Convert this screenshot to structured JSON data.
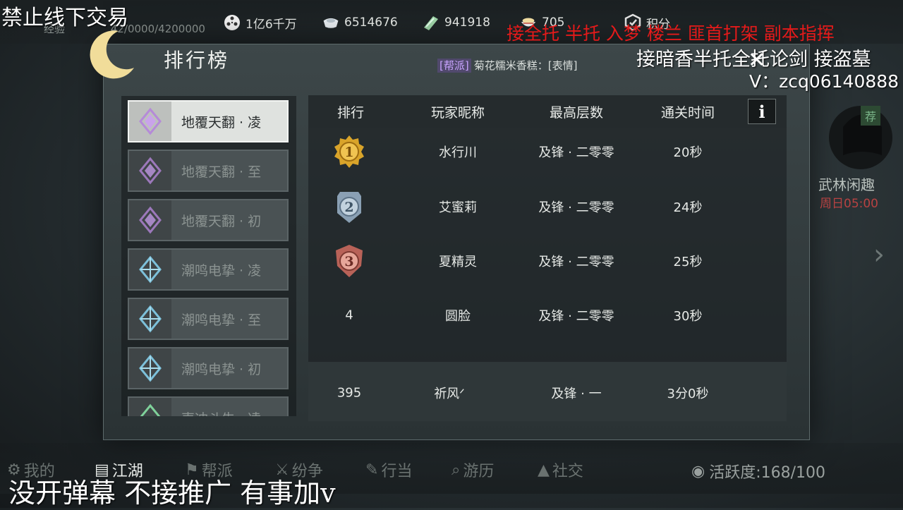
{
  "topbar": {
    "exp_label": "经验",
    "exp_value": "42/0000/4200000",
    "resources": [
      {
        "icon": "film-reel-icon",
        "value": "1亿6千万"
      },
      {
        "icon": "silver-ingot-icon",
        "value": "6514676"
      },
      {
        "icon": "jade-token-icon",
        "value": "941918"
      },
      {
        "icon": "bowl-icon",
        "value": "705"
      },
      {
        "icon": "points-badge-icon",
        "value": "积分"
      }
    ]
  },
  "panel": {
    "title": "排行榜",
    "chat_tag": "[帮派]",
    "chat_message": "菊花糯米香糕：[表情]"
  },
  "sidebar": {
    "items": [
      {
        "label": "地覆天翻 · 凌",
        "icon": "purple-crystal-icon",
        "active": true
      },
      {
        "label": "地覆天翻 · 至",
        "icon": "purple-crystal-icon"
      },
      {
        "label": "地覆天翻 · 初",
        "icon": "purple-crystal-icon"
      },
      {
        "label": "潮鸣电挚 · 凌",
        "icon": "blue-crystal-icon"
      },
      {
        "label": "潮鸣电挚 · 至",
        "icon": "blue-crystal-icon"
      },
      {
        "label": "潮鸣电挚 · 初",
        "icon": "blue-crystal-icon"
      },
      {
        "label": "声冲斗牛 · 凌",
        "icon": "green-crystal-icon"
      }
    ]
  },
  "table": {
    "headers": [
      "排行",
      "玩家昵称",
      "最高层数",
      "通关时间"
    ],
    "info_label": "i",
    "rows": [
      {
        "rank": "1",
        "name": "水行川",
        "floor": "及锋 · 二零零",
        "time": "20秒",
        "medal": "gold"
      },
      {
        "rank": "2",
        "name": "艾蜜莉",
        "floor": "及锋 · 二零零",
        "time": "24秒",
        "medal": "silver"
      },
      {
        "rank": "3",
        "name": "夏精灵",
        "floor": "及锋 · 二零零",
        "time": "25秒",
        "medal": "bronze"
      },
      {
        "rank": "4",
        "name": "圆脸",
        "floor": "及锋 · 二零零",
        "time": "30秒"
      }
    ],
    "my_row": {
      "rank": "395",
      "name": "祈风ᐟ",
      "floor": "及锋 · 一",
      "time": "3分0秒"
    }
  },
  "right_panel": {
    "rec_tag": "荐",
    "weekly_title": "武林闲趣",
    "weekly_time": "周日05:00"
  },
  "bottom_nav": {
    "items": [
      {
        "label": "我的",
        "icon": "gear-icon"
      },
      {
        "label": "江湖",
        "icon": "book-icon",
        "active": true
      },
      {
        "label": "帮派",
        "icon": "banner-icon"
      },
      {
        "label": "纷争",
        "icon": "crossed-swords-icon"
      },
      {
        "label": "行当",
        "icon": "brush-icon"
      },
      {
        "label": "游历",
        "icon": "magnifier-icon"
      },
      {
        "label": "社交",
        "icon": "mountains-icon"
      }
    ],
    "activity_label": "活跃度:168/100"
  },
  "overlays": {
    "top_left": "禁止线下交易",
    "red_banner": "接全托 半托 入梦 楼兰 匪首打架 副本指挥",
    "white_line": "接暗香半托全托论剑 接盗墓",
    "contact": "V：zcq06140888",
    "bottom": "没开弹幕 不接推广 有事加v"
  },
  "colors": {
    "gold_medal": "#d9a42a",
    "silver_medal": "#8aa0b4",
    "bronze_medal": "#b86258",
    "red_overlay": "#e51a1a",
    "purple_crystal": "#b58ad8",
    "blue_crystal": "#7cc0da"
  }
}
